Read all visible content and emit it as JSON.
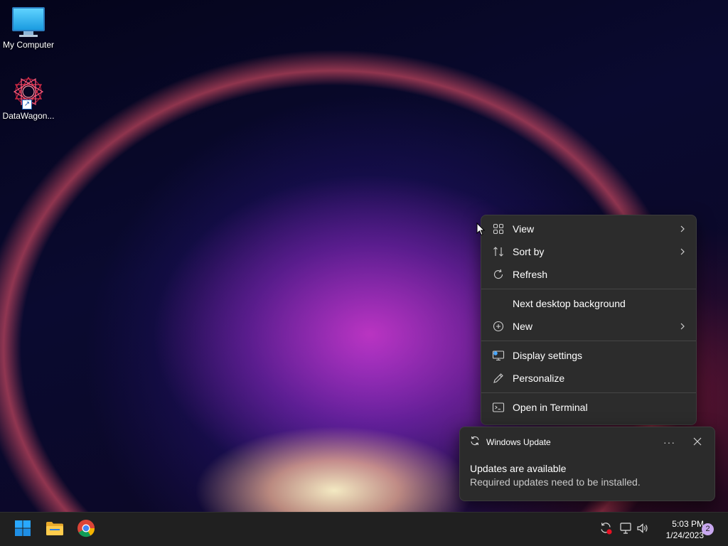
{
  "desktop": {
    "icons": [
      {
        "label": "My Computer",
        "icon": "monitor-icon"
      },
      {
        "label": "DataWagon...",
        "icon": "web-shortcut-icon"
      }
    ]
  },
  "context_menu": {
    "items": [
      {
        "label": "View",
        "icon": "grid-view-icon",
        "submenu": true
      },
      {
        "label": "Sort by",
        "icon": "sort-arrows-icon",
        "submenu": true
      },
      {
        "label": "Refresh",
        "icon": "refresh-icon",
        "submenu": false
      },
      {
        "label": "Next desktop background",
        "icon": "",
        "submenu": false
      },
      {
        "label": "New",
        "icon": "plus-circle-icon",
        "submenu": true
      },
      {
        "label": "Display settings",
        "icon": "display-settings-icon",
        "submenu": false
      },
      {
        "label": "Personalize",
        "icon": "pencil-icon",
        "submenu": false
      },
      {
        "label": "Open in Terminal",
        "icon": "terminal-icon",
        "submenu": false
      }
    ]
  },
  "toast": {
    "app_name": "Windows Update",
    "more_label": "···",
    "title": "Updates are available",
    "body": "Required updates need to be installed."
  },
  "taskbar": {
    "apps": [
      {
        "name": "Start",
        "icon": "windows-logo-icon"
      },
      {
        "name": "File Explorer",
        "icon": "folder-icon"
      },
      {
        "name": "Google Chrome",
        "icon": "chrome-icon"
      }
    ],
    "tray": {
      "icons": [
        "update-sync-icon",
        "network-icon",
        "volume-icon"
      ],
      "time": "5:03 PM",
      "date": "1/24/2023",
      "notification_count": "2"
    }
  },
  "colors": {
    "menu_bg": "#2c2c2c",
    "taskbar_bg": "#202020",
    "windows_blue": "#29a8ff",
    "badge": "#c9a8f0"
  }
}
